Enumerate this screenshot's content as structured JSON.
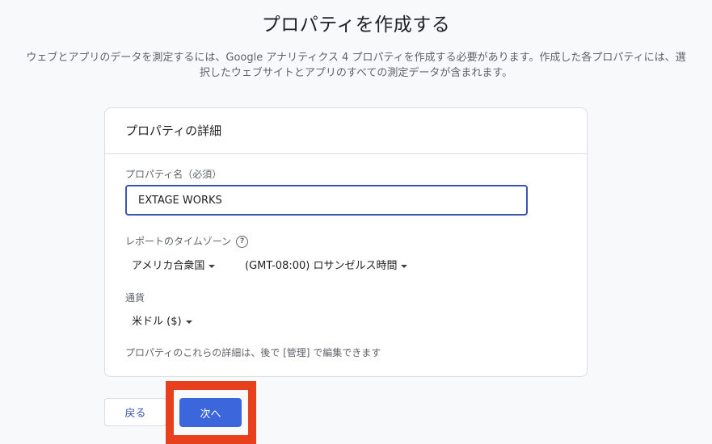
{
  "header": {
    "title": "プロパティを作成する",
    "intro": "ウェブとアプリのデータを測定するには、Google アナリティクス 4 プロパティを作成する必要があります。作成した各プロパティには、選択したウェブサイトとアプリのすべての測定データが含まれます。"
  },
  "card": {
    "title": "プロパティの詳細",
    "property_name": {
      "label": "プロパティ名（必須）",
      "value": "EXTAGE WORKS"
    },
    "timezone": {
      "label": "レポートのタイムゾーン",
      "help_icon": "help-circle-icon",
      "country": "アメリカ合衆国",
      "zone": "(GMT-08:00) ロサンゼルス時間"
    },
    "currency": {
      "label": "通貨",
      "value": "米ドル ($)"
    },
    "footnote": "プロパティのこれらの詳細は、後で [管理] で編集できます"
  },
  "actions": {
    "back_label": "戻る",
    "next_label": "次へ"
  },
  "colors": {
    "accent": "#3c67dc",
    "input_border": "#3c54b4",
    "highlight": "#e8401c"
  }
}
